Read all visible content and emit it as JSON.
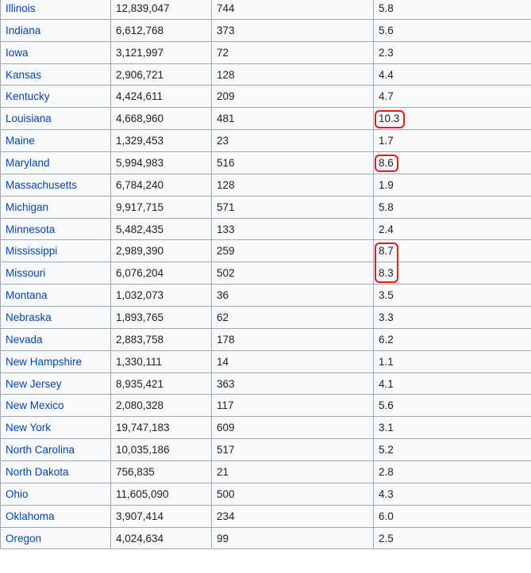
{
  "table": {
    "rows": [
      {
        "state": "Illinois",
        "population": "12,839,047",
        "murders": "744",
        "rate": "5.8"
      },
      {
        "state": "Indiana",
        "population": "6,612,768",
        "murders": "373",
        "rate": "5.6"
      },
      {
        "state": "Iowa",
        "population": "3,121,997",
        "murders": "72",
        "rate": "2.3"
      },
      {
        "state": "Kansas",
        "population": "2,906,721",
        "murders": "128",
        "rate": "4.4"
      },
      {
        "state": "Kentucky",
        "population": "4,424,611",
        "murders": "209",
        "rate": "4.7"
      },
      {
        "state": "Louisiana",
        "population": "4,668,960",
        "murders": "481",
        "rate": "10.3",
        "highlight": true
      },
      {
        "state": "Maine",
        "population": "1,329,453",
        "murders": "23",
        "rate": "1.7"
      },
      {
        "state": "Maryland",
        "population": "5,994,983",
        "murders": "516",
        "rate": "8.6",
        "highlight": true
      },
      {
        "state": "Massachusetts",
        "population": "6,784,240",
        "murders": "128",
        "rate": "1.9"
      },
      {
        "state": "Michigan",
        "population": "9,917,715",
        "murders": "571",
        "rate": "5.8"
      },
      {
        "state": "Minnesota",
        "population": "5,482,435",
        "murders": "133",
        "rate": "2.4"
      },
      {
        "state": "Mississippi",
        "population": "2,989,390",
        "murders": "259",
        "rate": "8.7",
        "highlight": true
      },
      {
        "state": "Missouri",
        "population": "6,076,204",
        "murders": "502",
        "rate": "8.3",
        "highlight": true
      },
      {
        "state": "Montana",
        "population": "1,032,073",
        "murders": "36",
        "rate": "3.5"
      },
      {
        "state": "Nebraska",
        "population": "1,893,765",
        "murders": "62",
        "rate": "3.3"
      },
      {
        "state": "Nevada",
        "population": "2,883,758",
        "murders": "178",
        "rate": "6.2"
      },
      {
        "state": "New Hampshire",
        "population": "1,330,111",
        "murders": "14",
        "rate": "1.1"
      },
      {
        "state": "New Jersey",
        "population": "8,935,421",
        "murders": "363",
        "rate": "4.1"
      },
      {
        "state": "New Mexico",
        "population": "2,080,328",
        "murders": "117",
        "rate": "5.6"
      },
      {
        "state": "New York",
        "population": "19,747,183",
        "murders": "609",
        "rate": "3.1"
      },
      {
        "state": "North Carolina",
        "population": "10,035,186",
        "murders": "517",
        "rate": "5.2"
      },
      {
        "state": "North Dakota",
        "population": "756,835",
        "murders": "21",
        "rate": "2.8"
      },
      {
        "state": "Ohio",
        "population": "11,605,090",
        "murders": "500",
        "rate": "4.3"
      },
      {
        "state": "Oklahoma",
        "population": "3,907,414",
        "murders": "234",
        "rate": "6.0"
      },
      {
        "state": "Oregon",
        "population": "4,024,634",
        "murders": "99",
        "rate": "2.5"
      }
    ]
  },
  "colors": {
    "link": "#0645ad",
    "highlight": "#e01a1f",
    "border": "#a2a9b1",
    "cell_bg": "#f8f9fa"
  }
}
